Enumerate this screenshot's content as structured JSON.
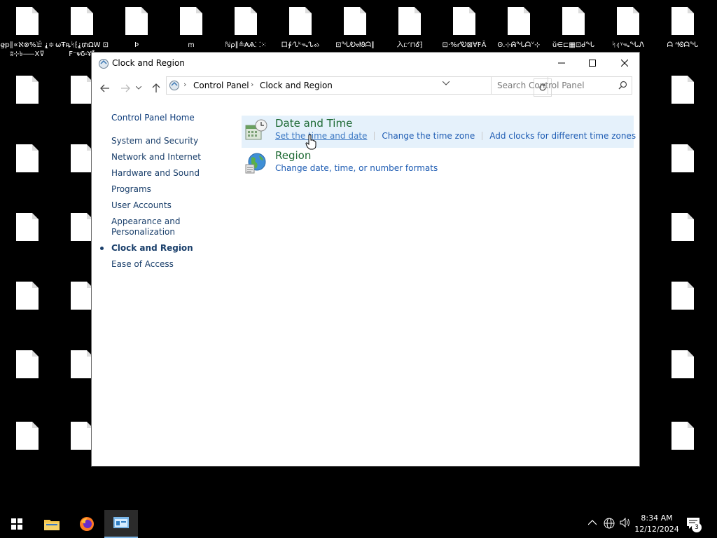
{
  "desktop": {
    "icons_top": [
      {
        "label": "ꞡ𝕡∥∝ℵ⊗%𓀀 ⸘≑ʬ⊹৳⸺X⊽"
      },
      {
        "label": "ωŦꝶᛋ⁅⸘₥ΩW ⊡Ϝ⁻ᴪδ⸚Ұ⁑"
      },
      {
        "label": "Ϸ"
      },
      {
        "label": "ꭑ"
      },
      {
        "label": "ℕρ∥≗₳Ѧ⸬⁙"
      },
      {
        "label": "ロ∳ᐧᔐᵏᯓᔐᨁ"
      },
      {
        "label": "⊡ᖓᎧᢦᘚᗩ∥"
      },
      {
        "label": "⼊ᥴᐟ⊓Ꮄ⁆"
      },
      {
        "label": "⊡·%ᓯᎧ⊠∀𐊥Ā"
      },
      {
        "label": "ʘ.⊹ᕱᖓᗩᘁ⊹"
      },
      {
        "label": "ŭ∈⊏▦⊡ᑯᖓ"
      },
      {
        "label": "ᛋ⦉ᵞᯓᖓᏁ"
      },
      {
        "label": "ᗩ ᐢᘚᗩᖓ"
      }
    ],
    "window_title": "Clock and Region"
  },
  "window": {
    "title": "Clock and Region",
    "breadcrumb": [
      "Control Panel",
      "Clock and Region"
    ],
    "search_placeholder": "Search Control Panel",
    "left_nav": {
      "home": "Control Panel Home",
      "items": [
        "System and Security",
        "Network and Internet",
        "Hardware and Sound",
        "Programs",
        "User Accounts",
        "Appearance and Personalization",
        "Clock and Region",
        "Ease of Access"
      ],
      "active": "Clock and Region"
    },
    "categories": [
      {
        "title": "Date and Time",
        "links": [
          "Set the time and date",
          "Change the time zone",
          "Add clocks for different time zones"
        ]
      },
      {
        "title": "Region",
        "links": [
          "Change date, time, or number formats"
        ]
      }
    ]
  },
  "taskbar": {
    "time": "8:34 AM",
    "date": "12/12/2024",
    "notification_count": "3"
  },
  "colors": {
    "accent": "#1e6a34",
    "link": "#1e5cb3",
    "highlight": "#e5f1fb"
  }
}
